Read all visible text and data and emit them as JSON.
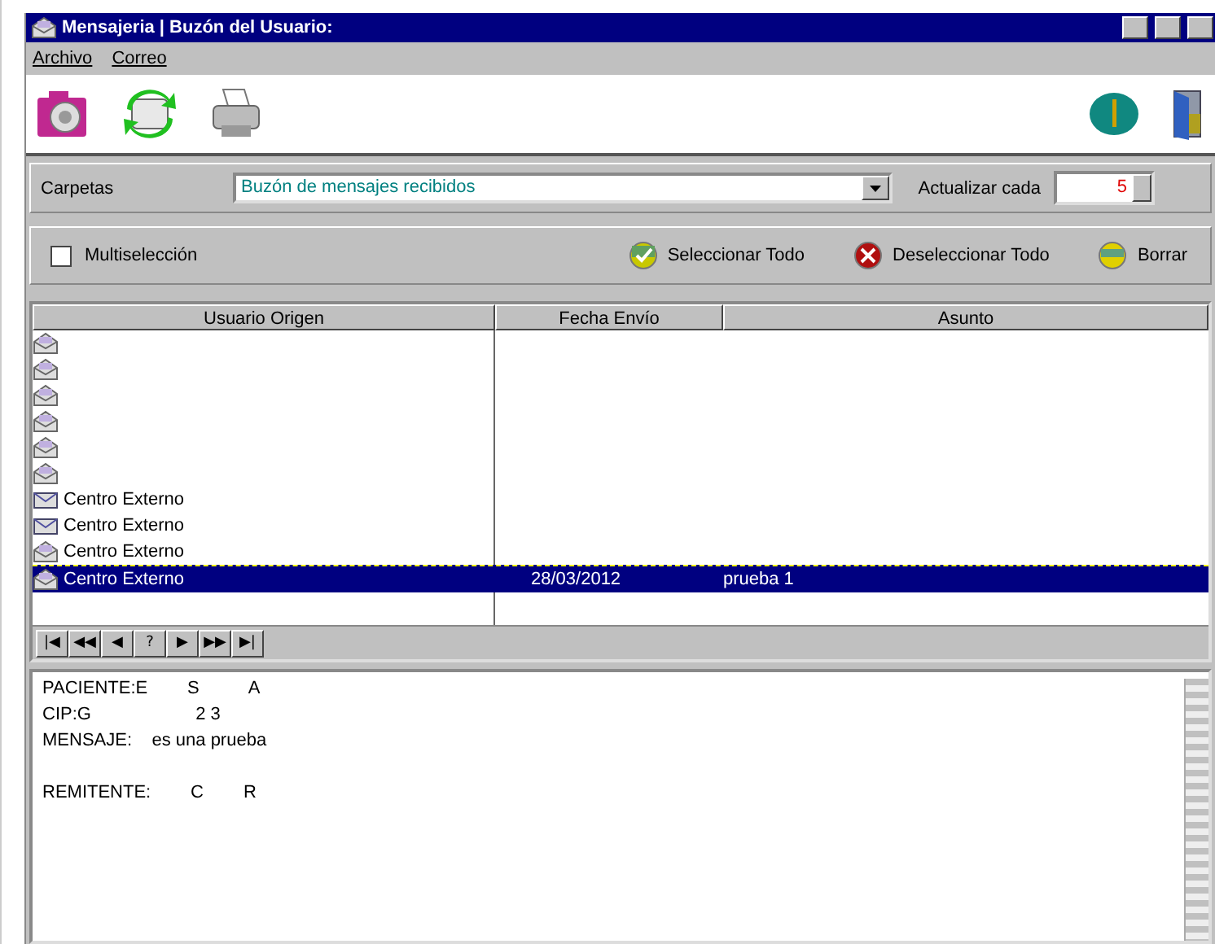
{
  "window": {
    "title": "Mensajeria | Buzón del Usuario:"
  },
  "menu": [
    {
      "label": "Archivo"
    },
    {
      "label": "Correo"
    }
  ],
  "folders": {
    "label": "Carpetas",
    "value": "Buzón de mensajes recibidos"
  },
  "refresh": {
    "label": "Actualizar cada",
    "value": "5"
  },
  "multiselect": {
    "label": "Multiselección",
    "checked": false
  },
  "actions": [
    {
      "kind": "select",
      "label": "Seleccionar Todo"
    },
    {
      "kind": "deselect",
      "label": "Deseleccionar Todo"
    },
    {
      "kind": "delete",
      "label": "Borrar"
    }
  ],
  "table": {
    "columns": [
      "Usuario Origen",
      "Fecha Envío",
      "Asunto"
    ],
    "rows": [
      {
        "read": true,
        "selected": false
      },
      {
        "read": true,
        "selected": false
      },
      {
        "read": true,
        "selected": false
      },
      {
        "read": true,
        "selected": false
      },
      {
        "read": true,
        "selected": false
      },
      {
        "read": true,
        "selected": false
      },
      {
        "user": "Centro Externo",
        "read": false,
        "selected": false
      },
      {
        "user": "Centro Externo",
        "read": false,
        "selected": false
      },
      {
        "user": "Centro Externo",
        "read": true,
        "selected": false
      },
      {
        "user": "Centro Externo",
        "date": "28/03/2012",
        "subject": "prueba 1",
        "read": true,
        "selected": true
      }
    ]
  },
  "navigator": [
    "|◀",
    "◀◀",
    "◀",
    "?",
    "▶",
    "▶▶",
    "▶|"
  ],
  "message": {
    "lines": [
      "PACIENTE:E        S          A",
      "CIP:G                     2 3",
      "MENSAJE:    es una prueba"
    ],
    "sender": "REMITENTE:        C        R"
  }
}
